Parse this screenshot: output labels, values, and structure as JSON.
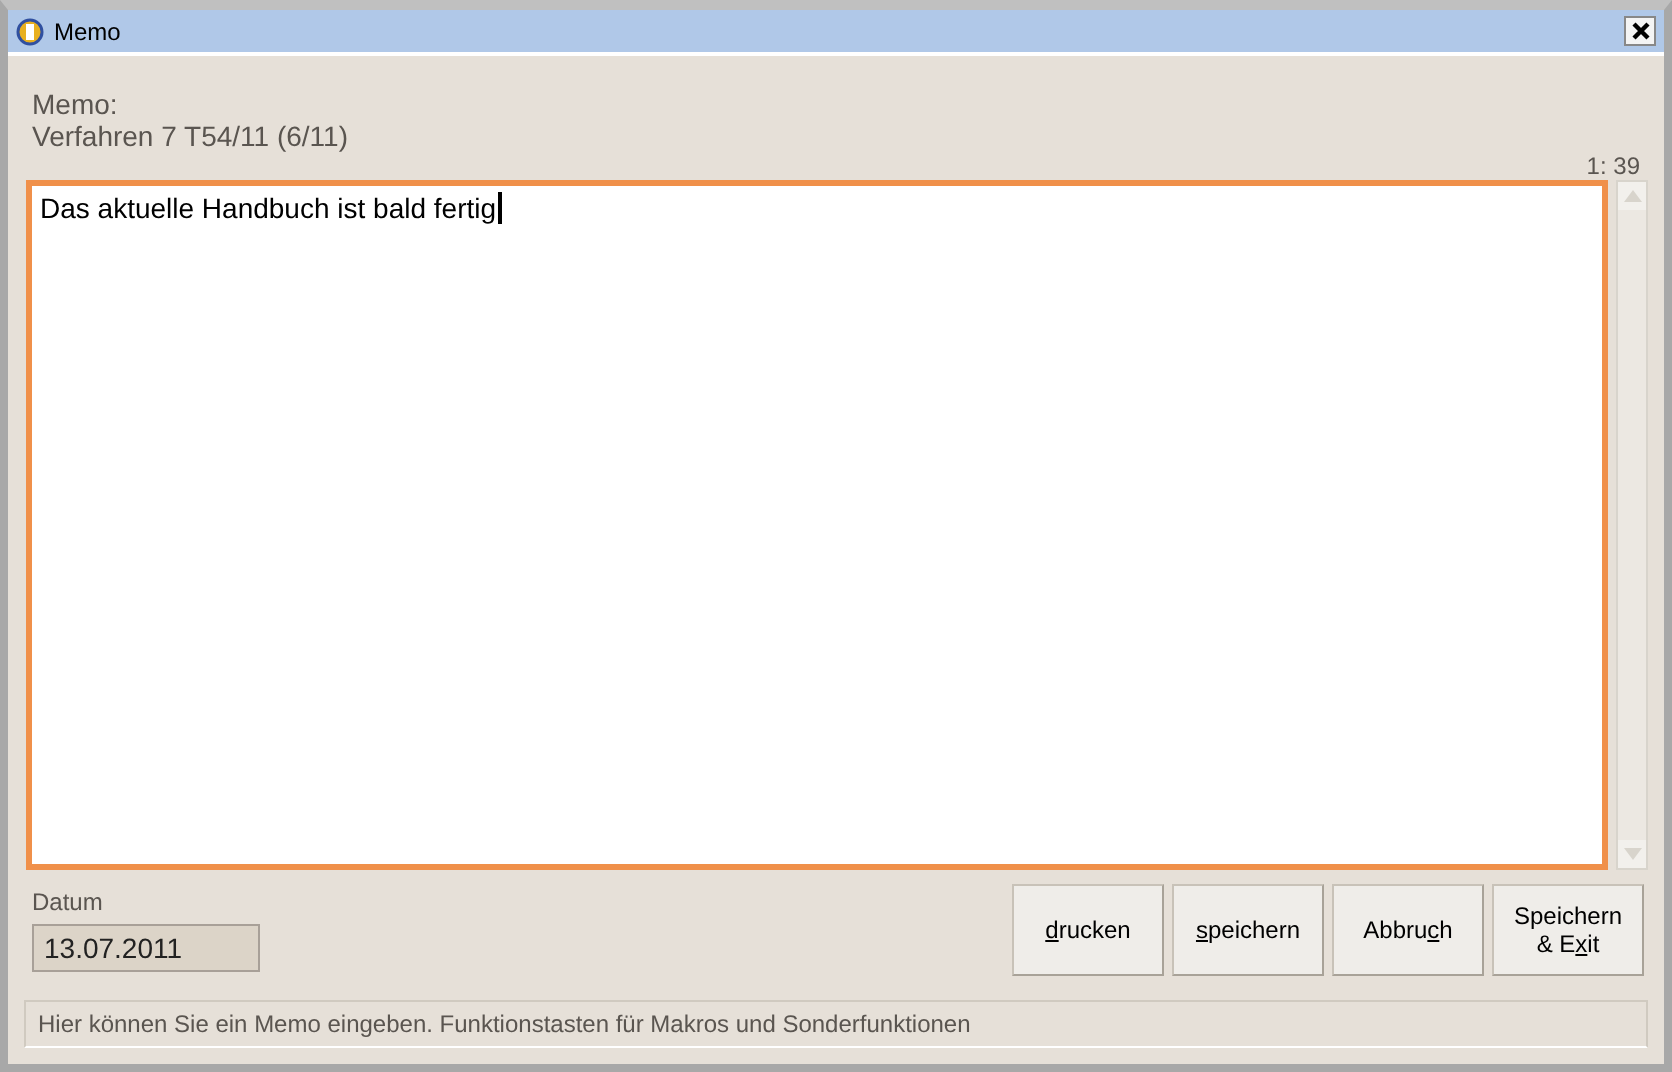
{
  "window": {
    "title": "Memo"
  },
  "header": {
    "label": "Memo:",
    "subtitle": "Verfahren 7 T54/11 (6/11)",
    "position": "1:  39"
  },
  "memo": {
    "value": "Das aktuelle Handbuch ist bald fertig"
  },
  "date": {
    "label": "Datum",
    "value": "13.07.2011"
  },
  "buttons": [
    {
      "key": "d",
      "after": "rucken"
    },
    {
      "key": "s",
      "after": "peichern"
    },
    {
      "before": "Abbru",
      "key": "c",
      "after": "h"
    },
    {
      "before": "Speichern & E",
      "key": "x",
      "after": "it"
    }
  ],
  "status_bar": "Hier können Sie ein Memo eingeben. Funktionstasten für Makros und Sonderfunktionen"
}
